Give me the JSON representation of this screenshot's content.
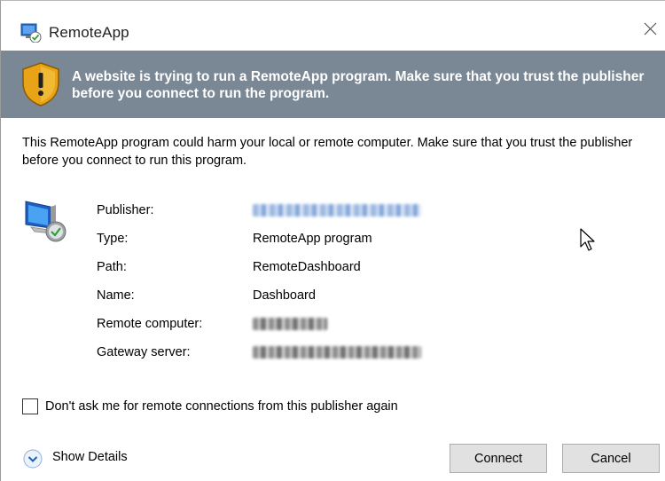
{
  "window": {
    "title": "RemoteApp",
    "icons": {
      "app": "remoteapp-icon",
      "close": "close-icon"
    }
  },
  "banner": {
    "text": "A website is trying to run a RemoteApp program. Make sure that you trust the publisher before you connect to run the program.",
    "background": "#7a8795",
    "icon": "shield-warning-icon"
  },
  "warning": {
    "text": "This RemoteApp program could harm your local or remote computer. Make sure that you trust the publisher before you connect to run this program."
  },
  "details": {
    "icon": "remote-computer-icon",
    "rows": [
      {
        "label": "Publisher:",
        "value": "",
        "redacted": true
      },
      {
        "label": "Type:",
        "value": "RemoteApp program",
        "redacted": false
      },
      {
        "label": "Path:",
        "value": "RemoteDashboard",
        "redacted": false
      },
      {
        "label": "Name:",
        "value": "Dashboard",
        "redacted": false
      },
      {
        "label": "Remote computer:",
        "value": "",
        "redacted": true
      },
      {
        "label": "Gateway server:",
        "value": "",
        "redacted": true
      }
    ]
  },
  "checkbox": {
    "label": "Don't ask me for remote connections from this publisher again",
    "checked": false
  },
  "footer": {
    "show_details_label": "Show Details",
    "connect_label": "Connect",
    "cancel_label": "Cancel"
  }
}
